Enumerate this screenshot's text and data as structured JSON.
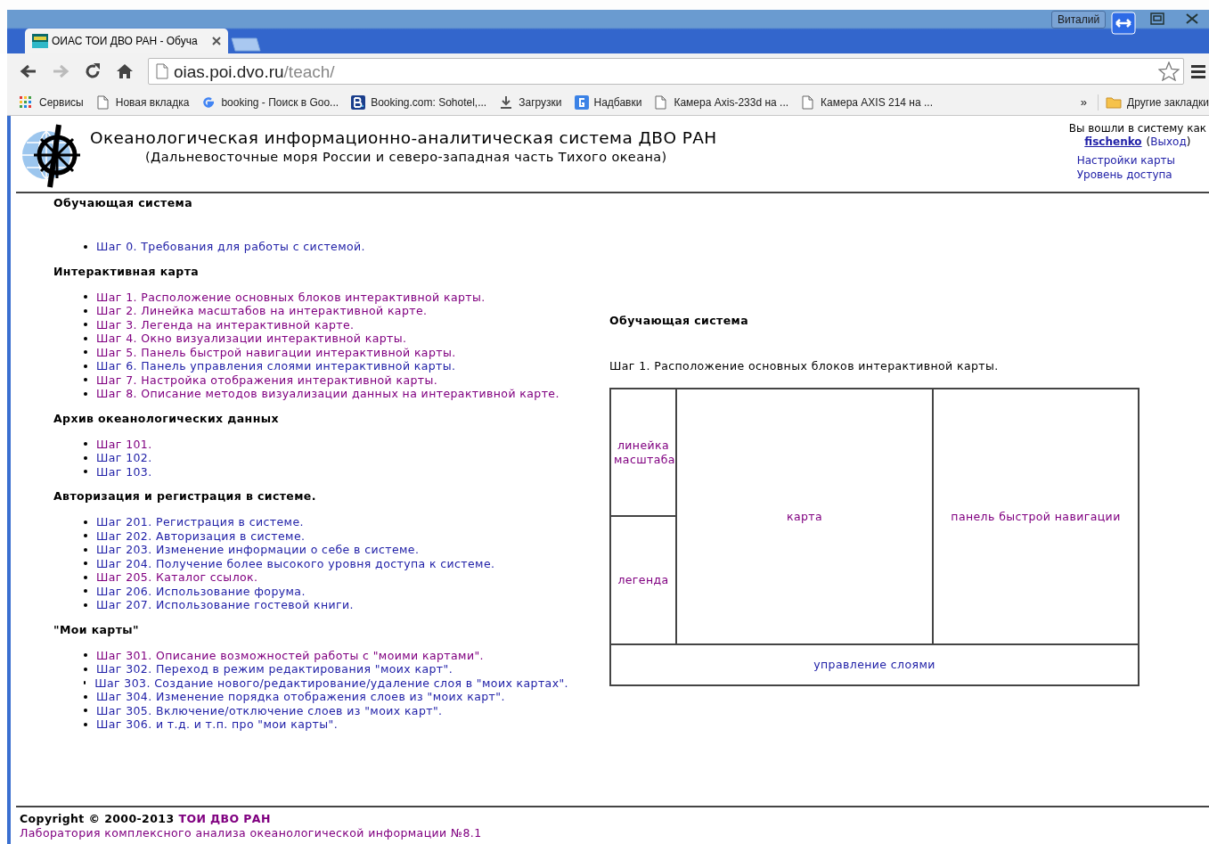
{
  "browser": {
    "user": "Виталий",
    "tab_title": "ОИАС ТОИ ДВО РАН - Обуча",
    "url_host": "oias.poi.dvo.ru",
    "url_path": "/teach/",
    "bookmarks": [
      {
        "kind": "apps",
        "label": "Сервисы"
      },
      {
        "kind": "page",
        "label": "Новая вкладка"
      },
      {
        "kind": "google",
        "label": "booking - Поиск в Goo..."
      },
      {
        "kind": "booking",
        "label": "Booking.com: Sohotel,..."
      },
      {
        "kind": "download",
        "label": "Загрузки"
      },
      {
        "kind": "plus",
        "label": "Надбавки"
      },
      {
        "kind": "page",
        "label": "Камера Axis-233d на ..."
      },
      {
        "kind": "page",
        "label": "Камера AXIS 214 на ..."
      }
    ],
    "overflow": "»",
    "other_bookmarks": "Другие закладки"
  },
  "header": {
    "title": "Океанологическая информационно-аналитическая система ДВО РАН",
    "subtitle": "(Дальневосточные моря России и северо-западная часть Тихого океана)",
    "login_prompt": "Вы вошли в систему как",
    "username": "fischenko",
    "paren_open": "(",
    "logout": "Выход",
    "paren_close": ")",
    "links": [
      {
        "text": "Настройки карты",
        "visited": false
      },
      {
        "text": "Уровень доступа",
        "visited": false
      }
    ]
  },
  "sections": [
    {
      "heading": "Обучающая система",
      "items": [
        {
          "text": "Шаг 0. Требования для работы с системой.",
          "visited": false
        }
      ]
    },
    {
      "heading": "Интерактивная карта",
      "items": [
        {
          "text": "Шаг 1. Расположение основных блоков интерактивной карты.",
          "visited": true
        },
        {
          "text": "Шаг 2. Линейка масштабов на интерактивной карте.",
          "visited": true
        },
        {
          "text": "Шаг 3. Легенда на интерактивной карте.",
          "visited": true
        },
        {
          "text": "Шаг 4. Окно визуализации интерактивной карты.",
          "visited": true
        },
        {
          "text": "Шаг 5. Панель быстрой навигации интерактивной карты.",
          "visited": true
        },
        {
          "text": "Шаг 6. Панель управления слоями интерактивной карты.",
          "visited": false
        },
        {
          "text": "Шаг 7. Настройка отображения интерактивной карты.",
          "visited": true
        },
        {
          "text": "Шаг 8. Описание методов визуализации данных на интерактивной карте.",
          "visited": true
        }
      ]
    },
    {
      "heading": "Архив океанологических данных",
      "items": [
        {
          "text": "Шаг 101.",
          "visited": true
        },
        {
          "text": "Шаг 102.",
          "visited": false
        },
        {
          "text": "Шаг 103.",
          "visited": false
        }
      ]
    },
    {
      "heading": "Авторизация и регистрация в системе.",
      "items": [
        {
          "text": "Шаг 201. Регистрация в системе.",
          "visited": false
        },
        {
          "text": "Шаг 202. Авторизация в системе.",
          "visited": false
        },
        {
          "text": "Шаг 203. Изменение информации о себе в системе.",
          "visited": false
        },
        {
          "text": "Шаг 204. Получение более высокого уровня доступа к системе.",
          "visited": false
        },
        {
          "text": "Шаг 205. Каталог ссылок.",
          "visited": true
        },
        {
          "text": "Шаг 206. Использование форума.",
          "visited": false
        },
        {
          "text": "Шаг 207. Использование гостевой книги.",
          "visited": false
        }
      ]
    },
    {
      "heading": "\"Мои карты\"",
      "items": [
        {
          "text": "Шаг 301. Описание возможностей работы с \"моими картами\".",
          "visited": true
        },
        {
          "text": "Шаг 302. Переход в режим редактирования \"моих карт\".",
          "visited": false
        },
        {
          "text": "Шаг 303. Создание нового/редактирование/удаление слоя в \"моих картах\".",
          "visited": false
        },
        {
          "text": "Шаг 304. Изменение порядка отображения слоев из \"моих карт\".",
          "visited": false
        },
        {
          "text": "Шаг 305. Включение/отключение слоев из \"моих карт\".",
          "visited": false
        },
        {
          "text": "Шаг 306. и т.д. и т.п. про \"мои карты\".",
          "visited": false
        }
      ]
    }
  ],
  "lesson": {
    "heading": "Обучающая система",
    "caption": "Шаг 1. Расположение основных блоков интерактивной карты.",
    "diagram": [
      {
        "kind": "scale",
        "label": "линейка масштаба",
        "visited": true
      },
      {
        "kind": "map",
        "label": "карта",
        "visited": true
      },
      {
        "kind": "navigation",
        "label": "панель быстрой навигации",
        "visited": true
      },
      {
        "kind": "legend",
        "label": "легенда",
        "visited": true
      },
      {
        "kind": "layers",
        "label": "управление слоями",
        "visited": false
      }
    ]
  },
  "footer": {
    "copyright": "Copyright © 2000-2013",
    "org": "ТОИ ДВО РАН",
    "lab": "Лаборатория комплексного анализа океанологической информации №8.1"
  }
}
